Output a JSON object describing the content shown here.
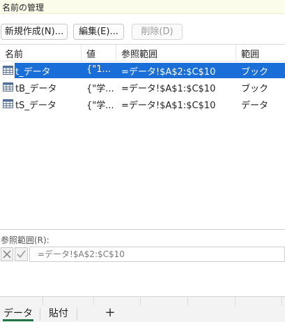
{
  "window": {
    "title": "名前の管理"
  },
  "toolbar": {
    "new_label": "新規作成(N)...",
    "edit_label": "編集(E)...",
    "delete_label": "削除(D)"
  },
  "list": {
    "columns": [
      "名前",
      "値",
      "参照範囲",
      "範囲"
    ],
    "rows": [
      {
        "name": "t_データ",
        "value": "{\"1...",
        "ref": "=データ!$A$2:$C$10",
        "scope": "ブック",
        "icon": "table-icon",
        "selected": true
      },
      {
        "name": "tB_データ",
        "value": "{\"学...",
        "ref": "=データ!$A$1:$C$10",
        "scope": "ブック",
        "icon": "table-icon",
        "selected": false
      },
      {
        "name": "tS_データ",
        "value": "{\"学...",
        "ref": "=データ!$A$1:$C$10",
        "scope": "データ",
        "icon": "table-icon",
        "selected": false
      }
    ]
  },
  "refbar": {
    "label": "参照範囲(R):",
    "value": "=データ!$A$2:$C$10",
    "cancel_icon": "x-icon",
    "confirm_icon": "check-icon"
  },
  "sheets": {
    "tabs": [
      "データ",
      "貼付"
    ],
    "active_tab": "データ",
    "add_label": "+"
  },
  "colors": {
    "selection": "#1a6ed8",
    "title_bg": "#fcfcea",
    "active_tab_underline": "#217346"
  }
}
